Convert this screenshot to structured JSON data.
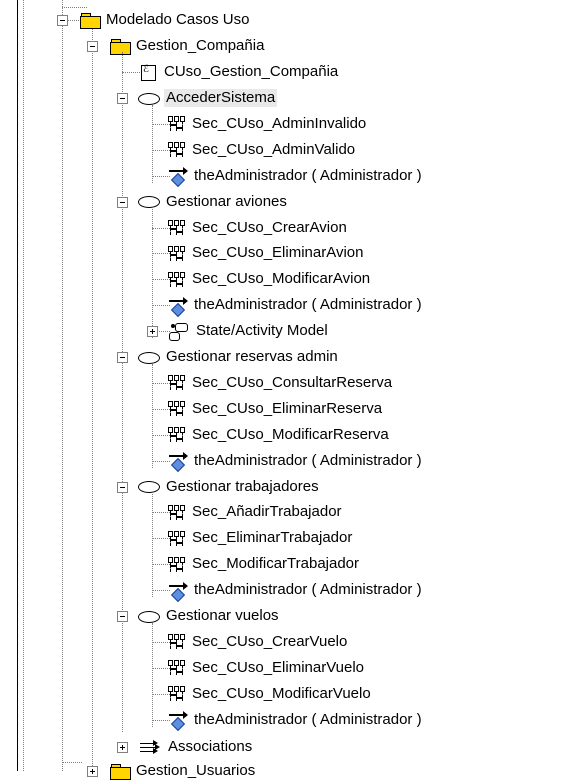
{
  "tree": {
    "root": {
      "label": "Modelado Casos Uso",
      "icon": "folder-icon",
      "state": "expanded"
    },
    "gestion_compania": {
      "label": "Gestion_Compañia",
      "icon": "folder-icon",
      "state": "expanded",
      "doc": {
        "label": "CUso_Gestion_Compañia",
        "icon": "use-case-documentation-icon"
      }
    },
    "use_cases": [
      {
        "label": "AccederSistema",
        "icon": "use-case-ellipse-icon",
        "state": "expanded",
        "selected": true,
        "children": [
          {
            "label": "Sec_CUso_AdminInvalido",
            "icon": "sequence-diagram-icon"
          },
          {
            "label": "Sec_CUso_AdminValido",
            "icon": "sequence-diagram-icon"
          },
          {
            "label": "theAdministrador ( Administrador )",
            "icon": "actor-association-icon"
          }
        ]
      },
      {
        "label": "Gestionar aviones",
        "icon": "use-case-ellipse-icon",
        "state": "expanded",
        "children": [
          {
            "label": "Sec_CUso_CrearAvion",
            "icon": "sequence-diagram-icon"
          },
          {
            "label": "Sec_CUso_EliminarAvion",
            "icon": "sequence-diagram-icon"
          },
          {
            "label": "Sec_CUso_ModificarAvion",
            "icon": "sequence-diagram-icon"
          },
          {
            "label": "theAdministrador ( Administrador )",
            "icon": "actor-association-icon"
          },
          {
            "label": "State/Activity Model",
            "icon": "state-activity-model-icon",
            "state": "collapsed"
          }
        ]
      },
      {
        "label": "Gestionar reservas admin",
        "icon": "use-case-ellipse-icon",
        "state": "expanded",
        "children": [
          {
            "label": "Sec_CUso_ConsultarReserva",
            "icon": "sequence-diagram-icon"
          },
          {
            "label": "Sec_CUso_EliminarReserva",
            "icon": "sequence-diagram-icon"
          },
          {
            "label": "Sec_CUso_ModificarReserva",
            "icon": "sequence-diagram-icon"
          },
          {
            "label": "theAdministrador ( Administrador )",
            "icon": "actor-association-icon"
          }
        ]
      },
      {
        "label": "Gestionar trabajadores",
        "icon": "use-case-ellipse-icon",
        "state": "expanded",
        "children": [
          {
            "label": "Sec_AñadirTrabajador",
            "icon": "sequence-diagram-icon"
          },
          {
            "label": "Sec_EliminarTrabajador",
            "icon": "sequence-diagram-icon"
          },
          {
            "label": "Sec_ModificarTrabajador",
            "icon": "sequence-diagram-icon"
          },
          {
            "label": "theAdministrador ( Administrador )",
            "icon": "actor-association-icon"
          }
        ]
      },
      {
        "label": "Gestionar vuelos",
        "icon": "use-case-ellipse-icon",
        "state": "expanded",
        "children": [
          {
            "label": "Sec_CUso_CrearVuelo",
            "icon": "sequence-diagram-icon"
          },
          {
            "label": "Sec_CUso_EliminarVuelo",
            "icon": "sequence-diagram-icon"
          },
          {
            "label": "Sec_CUso_ModificarVuelo",
            "icon": "sequence-diagram-icon"
          },
          {
            "label": "theAdministrador ( Administrador )",
            "icon": "actor-association-icon"
          }
        ]
      }
    ],
    "associations": {
      "label": "Associations",
      "icon": "associations-icon",
      "state": "collapsed"
    },
    "next_folder": {
      "label": "Gestion_Usuarios",
      "icon": "folder-icon",
      "state": "collapsed",
      "partially_visible": true
    }
  }
}
